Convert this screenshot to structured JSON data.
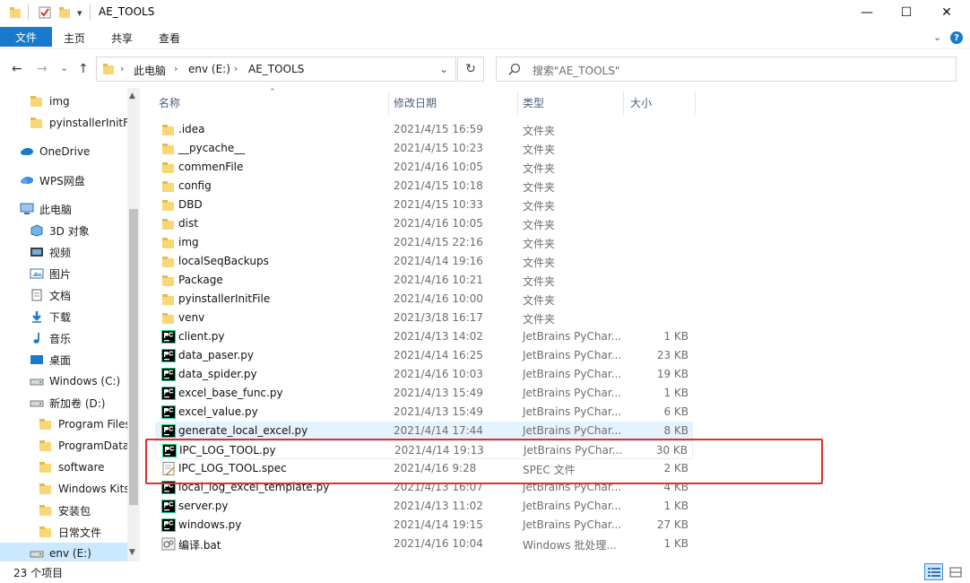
{
  "window": {
    "title": "AE_TOOLS",
    "quick_access_dropdown": "▾",
    "controls": {
      "minimize": "—",
      "maximize": "☐",
      "close": "✕"
    }
  },
  "ribbon": {
    "file_tab": "文件",
    "tabs": [
      "主页",
      "共享",
      "查看"
    ],
    "collapse": "⌄",
    "help": "?"
  },
  "address": {
    "back": "←",
    "forward": "→",
    "recent": "⌄",
    "up": "↑",
    "breadcrumbs": [
      "此电脑",
      "env (E:)",
      "AE_TOOLS"
    ],
    "separator": "›",
    "dropdown": "⌄",
    "refresh": "↻"
  },
  "search": {
    "placeholder": "搜索\"AE_TOOLS\""
  },
  "sidebar": {
    "items": [
      {
        "label": "img",
        "icon": "folder-icon",
        "indent": 1
      },
      {
        "label": "pyinstallerInitFi",
        "icon": "folder-icon",
        "indent": 1
      },
      {
        "label": "OneDrive",
        "icon": "cloud-icon",
        "indent": 0
      },
      {
        "label": "WPS网盘",
        "icon": "wps-cloud-icon",
        "indent": 0
      },
      {
        "label": "此电脑",
        "icon": "computer-icon",
        "indent": 0
      },
      {
        "label": "3D 对象",
        "icon": "cube-icon",
        "indent": 1
      },
      {
        "label": "视频",
        "icon": "video-icon",
        "indent": 1
      },
      {
        "label": "图片",
        "icon": "picture-icon",
        "indent": 1
      },
      {
        "label": "文档",
        "icon": "document-icon",
        "indent": 1
      },
      {
        "label": "下载",
        "icon": "download-icon",
        "indent": 1
      },
      {
        "label": "音乐",
        "icon": "music-icon",
        "indent": 1
      },
      {
        "label": "桌面",
        "icon": "desktop-icon",
        "indent": 1
      },
      {
        "label": "Windows (C:)",
        "icon": "drive-icon",
        "indent": 1
      },
      {
        "label": "新加卷 (D:)",
        "icon": "drive-icon",
        "indent": 1
      },
      {
        "label": "Program Files",
        "icon": "folder-icon",
        "indent": 2
      },
      {
        "label": "ProgramData",
        "icon": "folder-icon",
        "indent": 2
      },
      {
        "label": "software",
        "icon": "folder-icon",
        "indent": 2
      },
      {
        "label": "Windows Kits",
        "icon": "folder-icon",
        "indent": 2
      },
      {
        "label": "安装包",
        "icon": "folder-icon",
        "indent": 2
      },
      {
        "label": "日常文件",
        "icon": "folder-icon",
        "indent": 2
      },
      {
        "label": "env (E:)",
        "icon": "drive-icon",
        "indent": 1,
        "selected": true
      }
    ]
  },
  "columns": {
    "name": "名称",
    "date": "修改日期",
    "type": "类型",
    "size": "大小"
  },
  "files": [
    {
      "name": ".idea",
      "date": "2021/4/15 16:59",
      "type": "文件夹",
      "size": "",
      "kind": "folder"
    },
    {
      "name": "__pycache__",
      "date": "2021/4/15 10:23",
      "type": "文件夹",
      "size": "",
      "kind": "folder"
    },
    {
      "name": "commenFile",
      "date": "2021/4/16 10:05",
      "type": "文件夹",
      "size": "",
      "kind": "folder"
    },
    {
      "name": "config",
      "date": "2021/4/15 10:18",
      "type": "文件夹",
      "size": "",
      "kind": "folder"
    },
    {
      "name": "DBD",
      "date": "2021/4/15 10:33",
      "type": "文件夹",
      "size": "",
      "kind": "folder"
    },
    {
      "name": "dist",
      "date": "2021/4/16 10:05",
      "type": "文件夹",
      "size": "",
      "kind": "folder"
    },
    {
      "name": "img",
      "date": "2021/4/15 22:16",
      "type": "文件夹",
      "size": "",
      "kind": "folder"
    },
    {
      "name": "localSeqBackups",
      "date": "2021/4/14 19:16",
      "type": "文件夹",
      "size": "",
      "kind": "folder"
    },
    {
      "name": "Package",
      "date": "2021/4/16 10:21",
      "type": "文件夹",
      "size": "",
      "kind": "folder"
    },
    {
      "name": "pyinstallerInitFile",
      "date": "2021/4/16 10:00",
      "type": "文件夹",
      "size": "",
      "kind": "folder"
    },
    {
      "name": "venv",
      "date": "2021/3/18 16:17",
      "type": "文件夹",
      "size": "",
      "kind": "folder"
    },
    {
      "name": "client.py",
      "date": "2021/4/13 14:02",
      "type": "JetBrains PyChar...",
      "size": "1 KB",
      "kind": "py"
    },
    {
      "name": "data_paser.py",
      "date": "2021/4/14 16:25",
      "type": "JetBrains PyChar...",
      "size": "23 KB",
      "kind": "py"
    },
    {
      "name": "data_spider.py",
      "date": "2021/4/16 10:03",
      "type": "JetBrains PyChar...",
      "size": "19 KB",
      "kind": "py"
    },
    {
      "name": "excel_base_func.py",
      "date": "2021/4/13 15:49",
      "type": "JetBrains PyChar...",
      "size": "1 KB",
      "kind": "py"
    },
    {
      "name": "excel_value.py",
      "date": "2021/4/13 15:49",
      "type": "JetBrains PyChar...",
      "size": "6 KB",
      "kind": "py"
    },
    {
      "name": "generate_local_excel.py",
      "date": "2021/4/14 17:44",
      "type": "JetBrains PyChar...",
      "size": "8 KB",
      "kind": "py",
      "hover": true
    },
    {
      "name": "IPC_LOG_TOOL.py",
      "date": "2021/4/14 19:13",
      "type": "JetBrains PyChar...",
      "size": "30 KB",
      "kind": "py",
      "focus": true
    },
    {
      "name": "IPC_LOG_TOOL.spec",
      "date": "2021/4/16 9:28",
      "type": "SPEC 文件",
      "size": "2 KB",
      "kind": "spec"
    },
    {
      "name": "local_log_excel_template.py",
      "date": "2021/4/13 16:07",
      "type": "JetBrains PyChar...",
      "size": "4 KB",
      "kind": "py"
    },
    {
      "name": "server.py",
      "date": "2021/4/13 11:02",
      "type": "JetBrains PyChar...",
      "size": "1 KB",
      "kind": "py"
    },
    {
      "name": "windows.py",
      "date": "2021/4/14 19:15",
      "type": "JetBrains PyChar...",
      "size": "27 KB",
      "kind": "py"
    },
    {
      "name": "编译.bat",
      "date": "2021/4/16 10:04",
      "type": "Windows 批处理...",
      "size": "1 KB",
      "kind": "bat"
    }
  ],
  "status": {
    "item_count": "23 个项目"
  },
  "colors": {
    "accent": "#1979ca",
    "selection": "#cce8ff",
    "highlight_box": "#e0302a",
    "folder": "#f8d776"
  }
}
